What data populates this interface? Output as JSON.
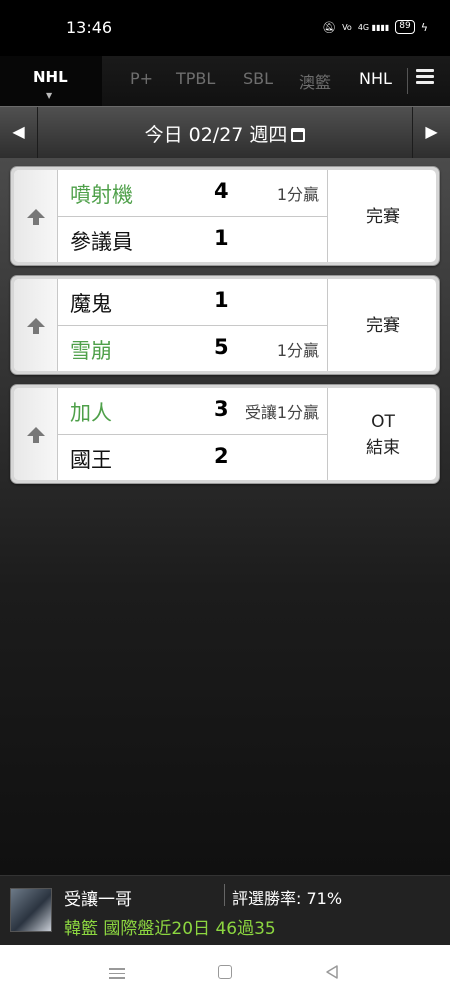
{
  "status_bar": {
    "time": "13:46",
    "icons": [
      "mute-icon",
      "volte-icon",
      "signal-icon"
    ],
    "network": "4G",
    "battery": "89"
  },
  "league_tabs": {
    "active": "NHL",
    "items": [
      "P+",
      "TPBL",
      "SBL",
      "澳籃",
      "NHL"
    ]
  },
  "date_bar": {
    "date_label": "今日 02/27 週四"
  },
  "games": [
    {
      "home": {
        "name": "噴射機",
        "score": "4",
        "note": "1分贏",
        "winner": true
      },
      "away": {
        "name": "參議員",
        "score": "1",
        "note": "",
        "winner": false
      },
      "status": "完賽"
    },
    {
      "home": {
        "name": "魔鬼",
        "score": "1",
        "note": "",
        "winner": false
      },
      "away": {
        "name": "雪崩",
        "score": "5",
        "note": "1分贏",
        "winner": true
      },
      "status": "完賽"
    },
    {
      "home": {
        "name": "加人",
        "score": "3",
        "note": "受讓1分贏",
        "winner": true
      },
      "away": {
        "name": "國王",
        "score": "2",
        "note": "",
        "winner": false
      },
      "status_line1": "OT",
      "status_line2": "結束"
    }
  ],
  "promo": {
    "name": "受讓一哥",
    "rate": "評選勝率: 71%",
    "record": "韓籃 國際盤近20日 46過35"
  },
  "colors": {
    "win_green": "#4fa04a",
    "promo_green": "#8cd640",
    "background": "#000000"
  }
}
